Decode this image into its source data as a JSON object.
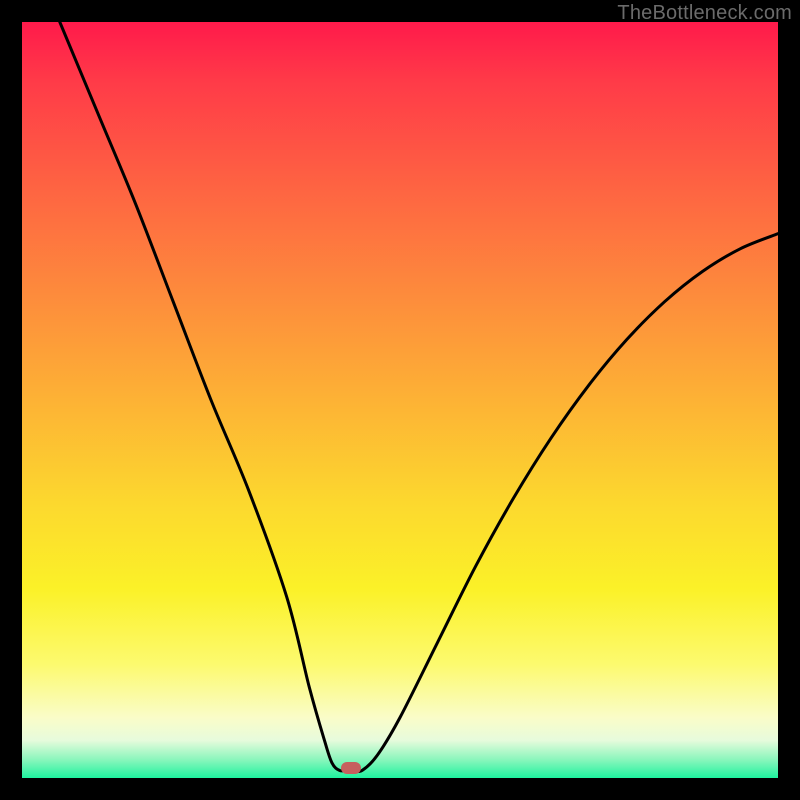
{
  "watermark": "TheBottleneck.com",
  "marker": {
    "x_frac": 0.435,
    "y_frac": 0.987
  },
  "chart_data": {
    "type": "line",
    "title": "",
    "xlabel": "",
    "ylabel": "",
    "xlim": [
      0,
      100
    ],
    "ylim": [
      0,
      100
    ],
    "series": [
      {
        "name": "bottleneck-curve",
        "x": [
          5,
          10,
          15,
          20,
          25,
          30,
          35,
          38,
          40,
          41,
          42,
          43,
          44,
          45,
          47,
          50,
          55,
          60,
          65,
          70,
          75,
          80,
          85,
          90,
          95,
          100
        ],
        "y": [
          100,
          88,
          76,
          63,
          50,
          38,
          24,
          12,
          5,
          2,
          1,
          1,
          1,
          1,
          3,
          8,
          18,
          28,
          37,
          45,
          52,
          58,
          63,
          67,
          70,
          72
        ]
      }
    ],
    "annotations": [
      {
        "type": "marker",
        "x": 43.5,
        "y": 1.3,
        "label": "optimal-point"
      }
    ],
    "background_gradient": {
      "orientation": "vertical",
      "stops": [
        {
          "pos": 0.0,
          "color": "#ff1a4b"
        },
        {
          "pos": 0.5,
          "color": "#fdb235"
        },
        {
          "pos": 0.75,
          "color": "#fbf128"
        },
        {
          "pos": 0.95,
          "color": "#e7fbdc"
        },
        {
          "pos": 1.0,
          "color": "#1ef39f"
        }
      ]
    }
  }
}
